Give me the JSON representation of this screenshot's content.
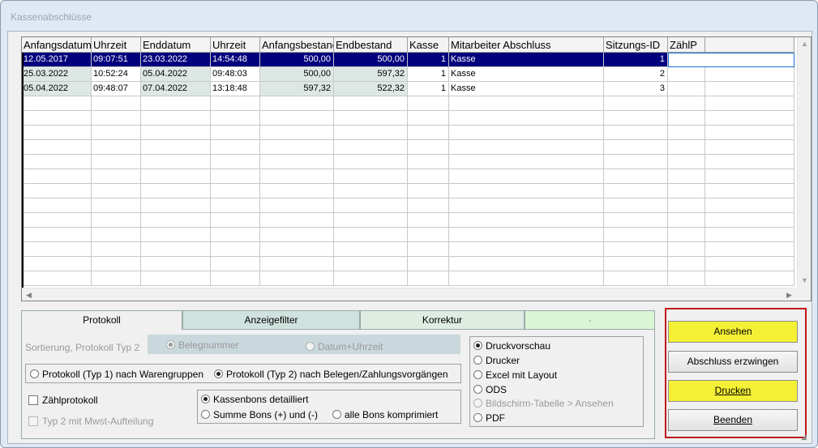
{
  "window": {
    "title": "Kassenabschlüsse"
  },
  "grid": {
    "columns": [
      "Anfangsdatum",
      "Uhrzeit",
      "Enddatum",
      "Uhrzeit",
      "Anfangsbestand",
      "Endbestand",
      "Kasse",
      "Mitarbeiter Abschluss",
      "Sitzungs-ID",
      "ZählP",
      ""
    ],
    "rows": [
      [
        "12.05.2017",
        "09:07:51",
        "23.03.2022",
        "14:54:48",
        "500,00",
        "500,00",
        "1",
        "Kasse",
        "1",
        "",
        ""
      ],
      [
        "25.03.2022",
        "10:52:24",
        "05.04.2022",
        "09:48:03",
        "500,00",
        "597,32",
        "1",
        "Kasse",
        "2",
        "",
        ""
      ],
      [
        "05.04.2022",
        "09:48:07",
        "07.04.2022",
        "13:18:48",
        "597,32",
        "522,32",
        "1",
        "Kasse",
        "3",
        "",
        ""
      ]
    ]
  },
  "tabs": [
    {
      "label": "Protokoll"
    },
    {
      "label": "Anzeigefilter"
    },
    {
      "label": "Korrektur"
    },
    {
      "label": "-"
    }
  ],
  "protokoll": {
    "sort_label": "Sortierung, Protokoll Typ 2",
    "sort_opt1": "Belegnummer",
    "sort_opt2": "Datum+Uhrzeit",
    "typ1": "Protokoll (Typ 1) nach Warengruppen",
    "typ2": "Protokoll (Typ 2) nach Belegen/Zahlungsvorgängen",
    "zaehlprotokoll": "Zählprotokoll",
    "typ2_mwst": "Typ 2 mit Mwst-Aufteilung",
    "bons_detailliert": "Kassenbons detailliert",
    "summe_bons": "Summe Bons (+) und (-)",
    "alle_bons": "alle Bons komprimiert",
    "output": [
      "Druckvorschau",
      "Drucker",
      "Excel mit Layout",
      "ODS",
      "Bildschirm-Tabelle > Ansehen",
      "PDF"
    ]
  },
  "buttons": {
    "ansehen": "Ansehen",
    "erzwingen": "Abschluss erzwingen",
    "drucken": "Drucken",
    "beenden": "Beenden"
  },
  "colors": {
    "highlight": "#f4f035",
    "selection": "#00007d",
    "frame": "#c0181a"
  }
}
